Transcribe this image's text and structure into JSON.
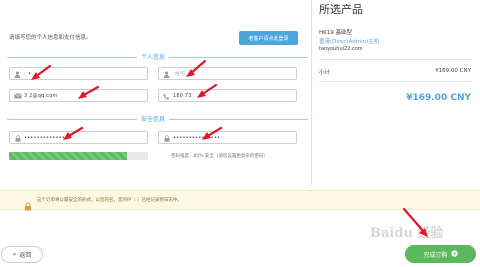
{
  "intro_text": "请填写您的个人信息和支付信息。",
  "login_button": "老客户请点此登录",
  "personal_section": "个人信息",
  "security_section": "安全信息",
  "fields": {
    "first_name": "•",
    "last_name_placeholder": "姓/名",
    "email": "3  2@qq.com",
    "phone": "180      73",
    "password": "•••••••••••••••",
    "password_confirm": "•••••••••••••••"
  },
  "password_strength": {
    "label": "密码强度：85% 安全（请您设置更复杂的密码）",
    "percent": 85
  },
  "notice_text": "这个订单将以最安全的形式，以您的名，您的IP（           ）已经记录到日志中。",
  "back_button": "返回",
  "summary": {
    "title": "所选产品",
    "product_name": "HK19 基础型",
    "product_sub": "香港(DirectAdmin)主机",
    "domain": "taoyouhui22.com",
    "subtotal_label": "小计",
    "subtotal_value": "¥169.00 CNY",
    "total_value": "¥169.00 CNY"
  },
  "checkout_button": "完成订购",
  "watermark": "Baidu 经验",
  "colors": {
    "accent": "#4aa6dc",
    "success": "#5cb85c",
    "arrow": "#e0182c",
    "notice_bg": "#fdf8e4"
  }
}
